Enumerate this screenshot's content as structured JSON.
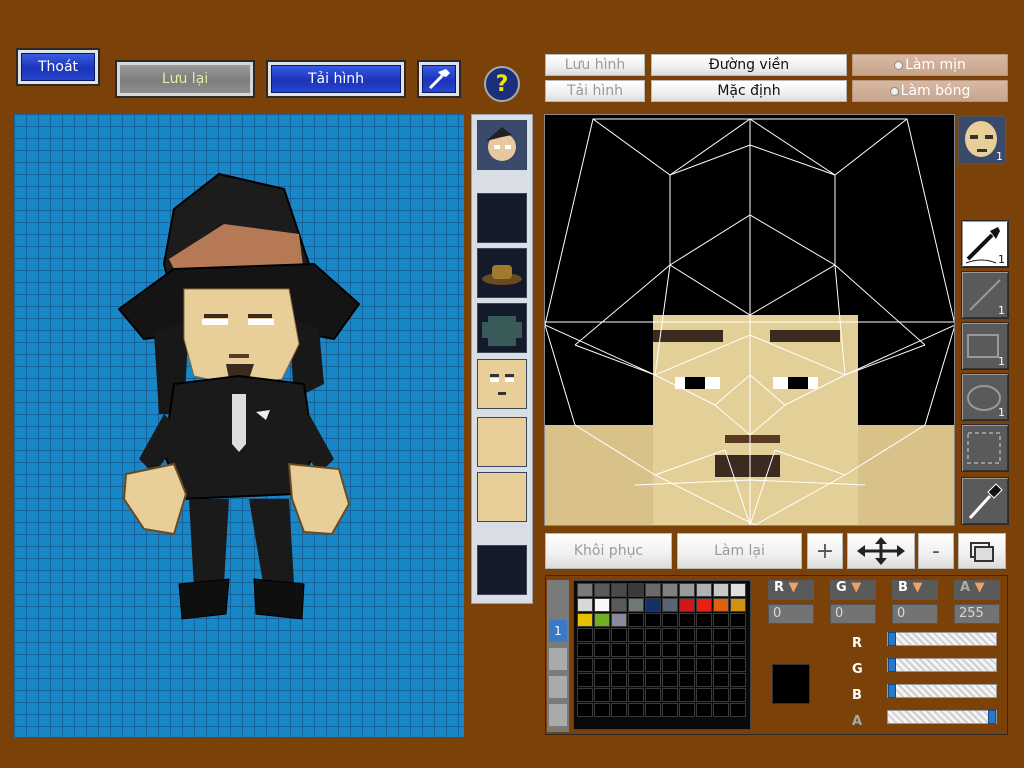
{
  "toolbar": {
    "exit_label": "Thoát",
    "save_label": "Lưu lại",
    "load_label": "Tải hình",
    "help_label": "?"
  },
  "editor": {
    "save_image_label": "Lưu hình",
    "load_image_label": "Tải hình",
    "outline_label": "Đường viền",
    "default_label": "Mặc định",
    "smooth_label": "Làm mịn",
    "shade_label": "Làm bóng",
    "restore_label": "Khôi phục",
    "redo_label": "Làm lại",
    "zoom_in_label": "+",
    "zoom_out_label": "-",
    "face_thumb_count": "1"
  },
  "tools": [
    {
      "name": "pen",
      "count": "1"
    },
    {
      "name": "line",
      "count": "1"
    },
    {
      "name": "rectangle",
      "count": "1"
    },
    {
      "name": "ellipse",
      "count": "1"
    },
    {
      "name": "selection",
      "count": ""
    },
    {
      "name": "eyedropper",
      "count": ""
    }
  ],
  "color": {
    "r_label": "R",
    "g_label": "G",
    "b_label": "B",
    "a_label": "A",
    "r_value": "0",
    "g_value": "0",
    "b_value": "0",
    "a_value": "255",
    "current": "#000000",
    "slider_r": 0,
    "slider_g": 0,
    "slider_b": 0,
    "slider_a": 1
  },
  "palette_tab_label": "1",
  "palette_colors": [
    "#7a7a7a",
    "#5a5a5a",
    "#4a4a4a",
    "#3a3a3a",
    "#6a6a6a",
    "#808080",
    "#9a9a9a",
    "#b0b0b0",
    "#c8c8c8",
    "#e0e0e0",
    "#d8d8d8",
    "#f8f8f8",
    "#5a5a5a",
    "#707878",
    "#14306a",
    "#5a6478",
    "#d01818",
    "#e82010",
    "#e06010",
    "#d09010",
    "#e8c000",
    "#70b020",
    "#8a8a9a"
  ],
  "accent_blue": "#1787c8",
  "background_brown": "#7a4209"
}
